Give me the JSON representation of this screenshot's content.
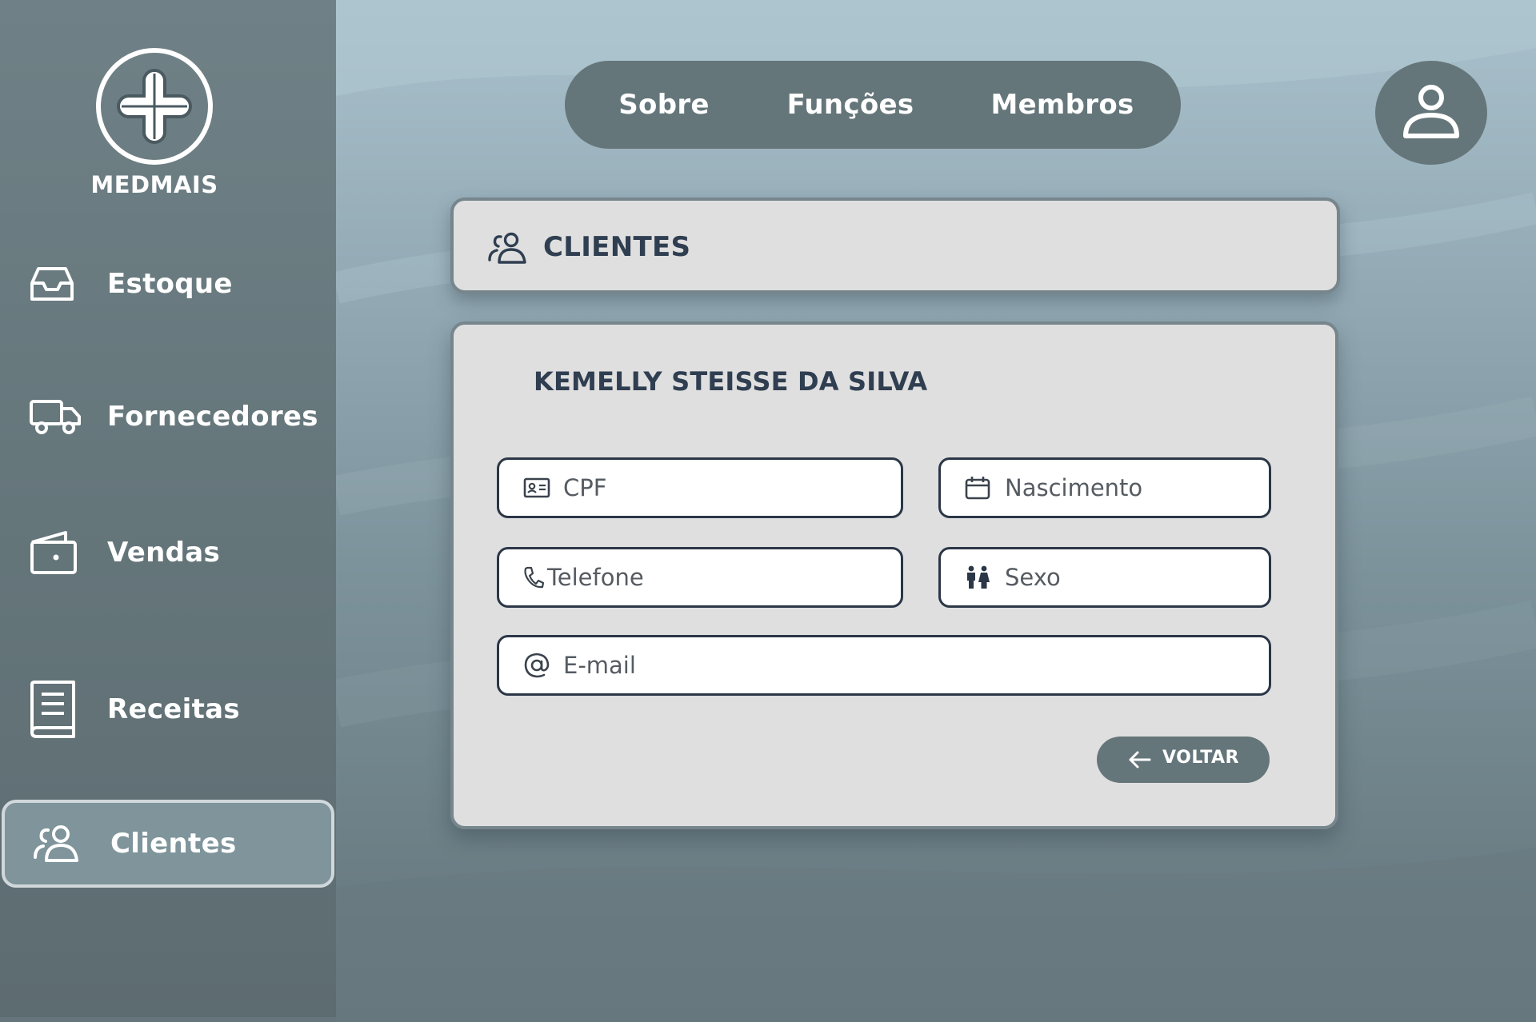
{
  "app": {
    "brand_name": "MEDMAIS"
  },
  "sidebar": {
    "items": [
      {
        "label": "Estoque",
        "icon": "inbox-icon"
      },
      {
        "label": "Fornecedores",
        "icon": "truck-icon"
      },
      {
        "label": "Vendas",
        "icon": "wallet-icon"
      },
      {
        "label": "Receitas",
        "icon": "book-icon"
      },
      {
        "label": "Clientes",
        "icon": "users-icon",
        "active": true
      }
    ]
  },
  "topnav": {
    "tabs": [
      {
        "label": "Sobre"
      },
      {
        "label": "Funções"
      },
      {
        "label": "Membros"
      }
    ]
  },
  "header": {
    "title": "CLIENTES",
    "icon": "users-icon"
  },
  "client": {
    "name": "KEMELLY STEISSE DA SILVA",
    "fields": {
      "cpf": {
        "placeholder": "CPF",
        "value": "",
        "icon": "id-card-icon"
      },
      "nascimento": {
        "placeholder": "Nascimento",
        "value": "",
        "icon": "calendar-icon"
      },
      "telefone": {
        "placeholder": "Telefone",
        "value": "",
        "icon": "phone-icon"
      },
      "sexo": {
        "placeholder": "Sexo",
        "value": "",
        "icon": "gender-icon"
      },
      "email": {
        "placeholder": "E-mail",
        "value": "",
        "icon": "at-sign-icon"
      }
    },
    "back_label": "VOLTAR"
  },
  "colors": {
    "sidebar_bg": "#65767b",
    "pill_bg": "#65767a",
    "card_bg": "#dfdfdf",
    "text_dark": "#2f3e50",
    "active_item_bg": "#7f949b"
  }
}
